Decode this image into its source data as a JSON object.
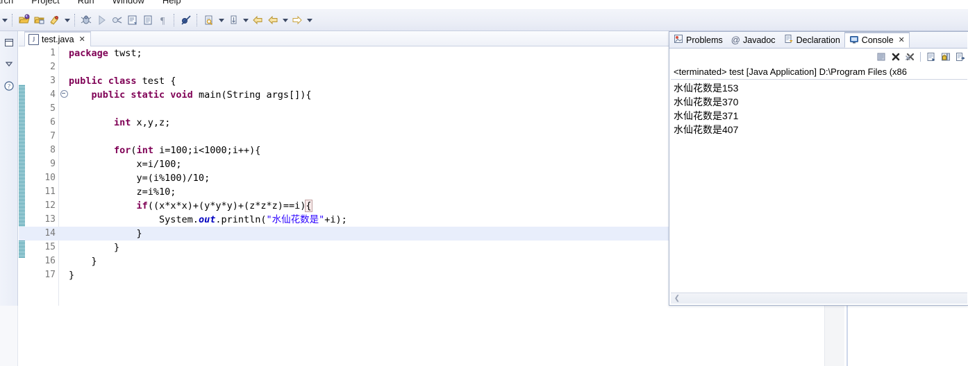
{
  "menu": {
    "items": [
      "arch",
      "Project",
      "Run",
      "Window",
      "Help"
    ]
  },
  "toolbar": {
    "icons": [
      "new-dropdown-caret-icon",
      "new-wizard-icon",
      "save-icon",
      "print-icon",
      "new-java-dropdown-caret-icon",
      "debug-icon",
      "run-icon",
      "external-tools-icon",
      "open-type-icon",
      "open-task-icon",
      "paragraph-mark-icon",
      "skip-breakpoints-icon",
      "search-icon",
      "search-dropdown-caret-icon",
      "next-annotation-icon",
      "annotation-dropdown-caret-icon",
      "back-icon",
      "forward-icon",
      "forward-dropdown-caret-icon",
      "next-edit-icon",
      "next-edit-dropdown-caret-icon"
    ]
  },
  "left_trim": {
    "icons": [
      "restore-view-icon",
      "minimize-chevron-icon",
      "help-question-icon"
    ]
  },
  "editor": {
    "tab": {
      "label": "test.java",
      "file_icon": "java-file-icon",
      "close_icon": "close-icon",
      "close_glyph": "✕"
    },
    "current_line": 14,
    "lines": [
      {
        "num": "1",
        "fold": "",
        "tokens": [
          {
            "t": "package",
            "c": "kw"
          },
          {
            "t": " twst;",
            "c": "plain"
          }
        ]
      },
      {
        "num": "2",
        "fold": "",
        "tokens": [
          {
            "t": "",
            "c": "plain"
          }
        ]
      },
      {
        "num": "3",
        "fold": "",
        "tokens": [
          {
            "t": "public class",
            "c": "kw"
          },
          {
            "t": " test {",
            "c": "plain"
          }
        ]
      },
      {
        "num": "4",
        "fold": "minus",
        "tokens": [
          {
            "t": "    ",
            "c": "plain"
          },
          {
            "t": "public static void",
            "c": "kw"
          },
          {
            "t": " main(String args[]){",
            "c": "plain"
          }
        ]
      },
      {
        "num": "5",
        "fold": "",
        "tokens": [
          {
            "t": "",
            "c": "plain"
          }
        ]
      },
      {
        "num": "6",
        "fold": "",
        "tokens": [
          {
            "t": "        ",
            "c": "plain"
          },
          {
            "t": "int",
            "c": "kw"
          },
          {
            "t": " x,y,z;",
            "c": "plain"
          }
        ]
      },
      {
        "num": "7",
        "fold": "",
        "tokens": [
          {
            "t": "",
            "c": "plain"
          }
        ]
      },
      {
        "num": "8",
        "fold": "",
        "tokens": [
          {
            "t": "        ",
            "c": "plain"
          },
          {
            "t": "for",
            "c": "kw"
          },
          {
            "t": "(",
            "c": "plain"
          },
          {
            "t": "int",
            "c": "kw"
          },
          {
            "t": " i=100;i<1000;i++){",
            "c": "plain"
          }
        ]
      },
      {
        "num": "9",
        "fold": "",
        "tokens": [
          {
            "t": "            x=i/100;",
            "c": "plain"
          }
        ]
      },
      {
        "num": "10",
        "fold": "",
        "tokens": [
          {
            "t": "            y=(i%100)/10;",
            "c": "plain"
          }
        ]
      },
      {
        "num": "11",
        "fold": "",
        "tokens": [
          {
            "t": "            z=i%10;",
            "c": "plain"
          }
        ]
      },
      {
        "num": "12",
        "fold": "",
        "tokens": [
          {
            "t": "            ",
            "c": "plain"
          },
          {
            "t": "if",
            "c": "kw"
          },
          {
            "t": "((x*x*x)+(y*y*y)+(z*z*z)==i)",
            "c": "plain"
          },
          {
            "t": "{",
            "c": "bracket-hl"
          }
        ]
      },
      {
        "num": "13",
        "fold": "",
        "tokens": [
          {
            "t": "                System.",
            "c": "plain"
          },
          {
            "t": "out",
            "c": "fld"
          },
          {
            "t": ".println(",
            "c": "plain"
          },
          {
            "t": "\"水仙花数是\"",
            "c": "str"
          },
          {
            "t": "+i);",
            "c": "plain"
          }
        ]
      },
      {
        "num": "14",
        "fold": "",
        "tokens": [
          {
            "t": "            }",
            "c": "plain"
          }
        ]
      },
      {
        "num": "15",
        "fold": "",
        "tokens": [
          {
            "t": "        }",
            "c": "plain"
          }
        ]
      },
      {
        "num": "16",
        "fold": "",
        "tokens": [
          {
            "t": "    }",
            "c": "plain"
          }
        ]
      },
      {
        "num": "17",
        "fold": "",
        "tokens": [
          {
            "t": "}",
            "c": "plain"
          }
        ]
      }
    ]
  },
  "console_view": {
    "tabs": [
      {
        "label": "Problems",
        "icon": "problems-icon",
        "active": false
      },
      {
        "label": "Javadoc",
        "icon": "at-sign-icon",
        "active": false
      },
      {
        "label": "Declaration",
        "icon": "declaration-icon",
        "active": false
      },
      {
        "label": "Console",
        "icon": "console-icon",
        "active": true
      }
    ],
    "active_tab_close_glyph": "✕",
    "toolbar_icons": [
      "clear-console-icon",
      "terminate-icon",
      "remove-all-terminated-icon",
      "scroll-lock-icon",
      "pin-console-icon",
      "display-selected-console-icon"
    ],
    "header": "<terminated> test [Java Application] D:\\Program Files (x86",
    "output": [
      "水仙花数是153",
      "水仙花数是370",
      "水仙花数是371",
      "水仙花数是407"
    ],
    "hscroll_left_glyph": "❮"
  }
}
